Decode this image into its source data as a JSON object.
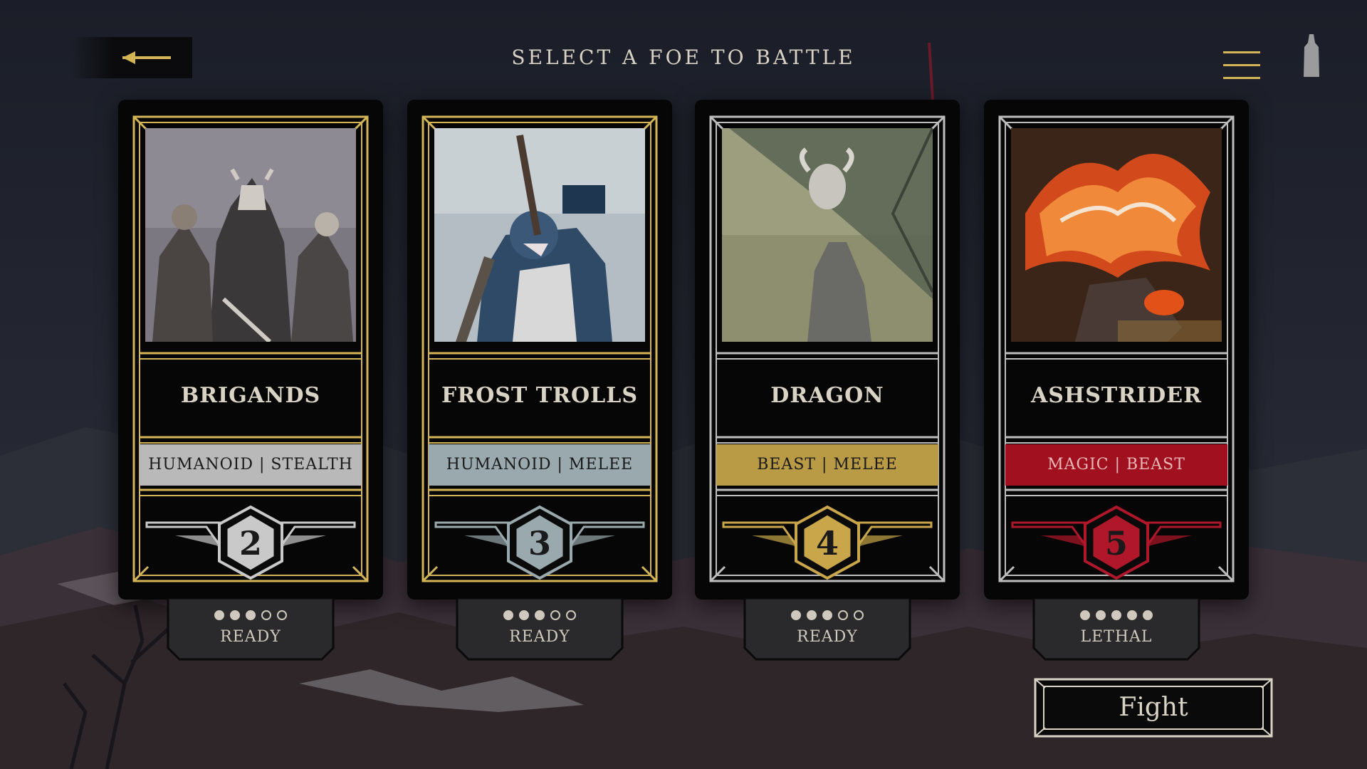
{
  "header": {
    "title": "SELECT A FOE TO BATTLE",
    "back_icon": "left-arrow-icon",
    "menu_icon": "hamburger-menu-icon",
    "tower_icon": "tower-icon"
  },
  "theme": {
    "gold": "#d3b558",
    "silver": "#b8b8b8",
    "red": "#b0172a"
  },
  "foes": [
    {
      "name": "BRIGANDS",
      "tags": "HUMANOID | STEALTH",
      "level": "2",
      "danger_filled": 3,
      "danger_total": 5,
      "status": "READY",
      "frame_color": "#d3b558",
      "tag_bg": "#b9b9b9",
      "tag_fg": "#1a1a1a",
      "accent": "#c9c9c9",
      "portrait": "brigands-portrait"
    },
    {
      "name": "FROST TROLLS",
      "tags": "HUMANOID | MELEE",
      "level": "3",
      "danger_filled": 3,
      "danger_total": 5,
      "status": "READY",
      "frame_color": "#d3b558",
      "tag_bg": "#9aa9ae",
      "tag_fg": "#1a1a1a",
      "accent": "#9aa9ae",
      "portrait": "frost-trolls-portrait"
    },
    {
      "name": "DRAGON",
      "tags": "BEAST | MELEE",
      "level": "4",
      "danger_filled": 3,
      "danger_total": 5,
      "status": "READY",
      "frame_color": "#bdbdbd",
      "tag_bg": "#b99a45",
      "tag_fg": "#1a1a1a",
      "accent": "#c9a64a",
      "portrait": "dragon-portrait"
    },
    {
      "name": "ASHSTRIDER",
      "tags": "MAGIC | BEAST",
      "level": "5",
      "danger_filled": 5,
      "danger_total": 5,
      "status": "LETHAL",
      "frame_color": "#bdbdbd",
      "tag_bg": "#a0101f",
      "tag_fg": "#e9b7b7",
      "accent": "#b0172a",
      "portrait": "ashstrider-portrait"
    }
  ],
  "fight_button": {
    "label": "Fight"
  }
}
